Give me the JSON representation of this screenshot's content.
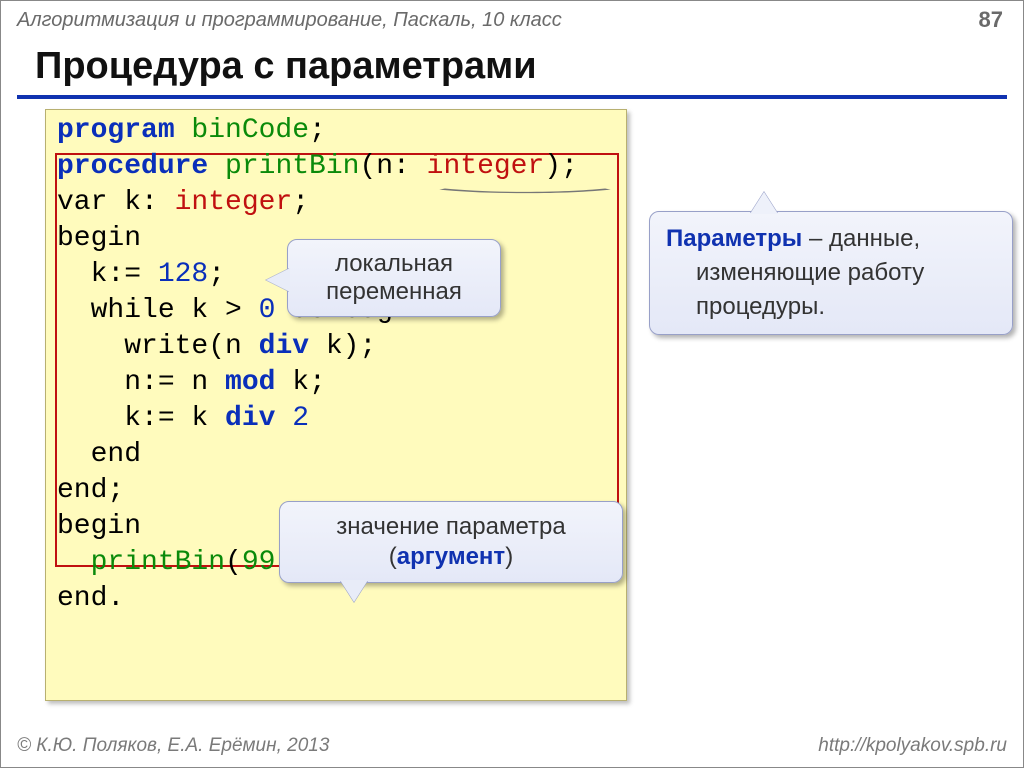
{
  "header": "Алгоритмизация и программирование, Паскаль, 10 класс",
  "page_number": "87",
  "title": "Процедура с параметрами",
  "code": {
    "l1_a": "program ",
    "l1_b": "binCode",
    "l1_c": ";",
    "l2_a": "procedure ",
    "l2_b": "printBin",
    "l2_c": "(n: ",
    "l2_d": "integer",
    "l2_e": ");",
    "l3_a": "var k: ",
    "l3_b": "integer",
    "l3_c": ";",
    "l4": "begin",
    "l5_a": "  k:= ",
    "l5_b": "128",
    "l5_c": ";",
    "l6_a": "  while k > ",
    "l6_b": "0",
    "l6_c": " do begin",
    "l7_a": "    write(n ",
    "l7_b": "div",
    "l7_c": " k);",
    "l8_a": "    n:= n ",
    "l8_b": "mod",
    "l8_c": " k;",
    "l9_a": "    k:= k ",
    "l9_b": "div",
    "l9_c": " ",
    "l9_d": "2",
    "l10": "  end",
    "l11": "end;",
    "l12": "begin",
    "l13_a": "  ",
    "l13_b": "printBin",
    "l13_c": "(",
    "l13_d": "99",
    "l13_e": ")",
    "l14": "end."
  },
  "callouts": {
    "local_line1": "локальная",
    "local_line2": "переменная",
    "param_bold": "Параметры",
    "param_rest1": " – данные,",
    "param_rest2": "изменяющие работу процедуры.",
    "arg_line1": "значение параметра",
    "arg_paren_open": "(",
    "arg_bold": "аргумент",
    "arg_paren_close": ")"
  },
  "footer": {
    "left": "© К.Ю. Поляков, Е.А. Ерёмин, 2013",
    "right": "http://kpolyakov.spb.ru"
  }
}
